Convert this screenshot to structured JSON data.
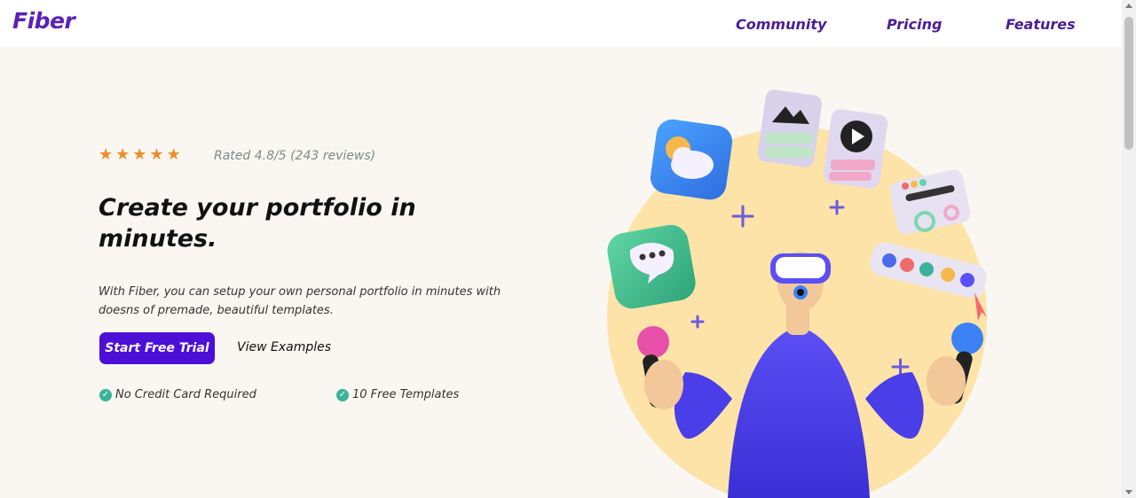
{
  "brand": {
    "name": "Fiber"
  },
  "nav": {
    "items": [
      "Community",
      "Pricing",
      "Features"
    ]
  },
  "hero": {
    "rating_text": "Rated 4.8/5 (243 reviews)",
    "stars": 5,
    "headline": "Create your portfolio in minutes.",
    "description": "With Fiber, you can setup your own personal portfolio in minutes with doesns of premade, beautiful templates.",
    "primary_cta": "Start Free Trial",
    "secondary_cta": "View Examples",
    "features": [
      "No Credit Card Required",
      "10 Free Templates"
    ]
  },
  "colors": {
    "brand": "#5b21b6",
    "cta_background": "#4c0fd8",
    "star": "#f28c28",
    "check": "#3cb29a",
    "page_background": "#faf7f3"
  },
  "icons": [
    "star-icon",
    "check-icon",
    "weather-app-icon",
    "image-card-icon",
    "video-card-icon",
    "chat-app-icon",
    "settings-card-icon",
    "color-palette-icon",
    "vr-headset-person-illustration"
  ]
}
